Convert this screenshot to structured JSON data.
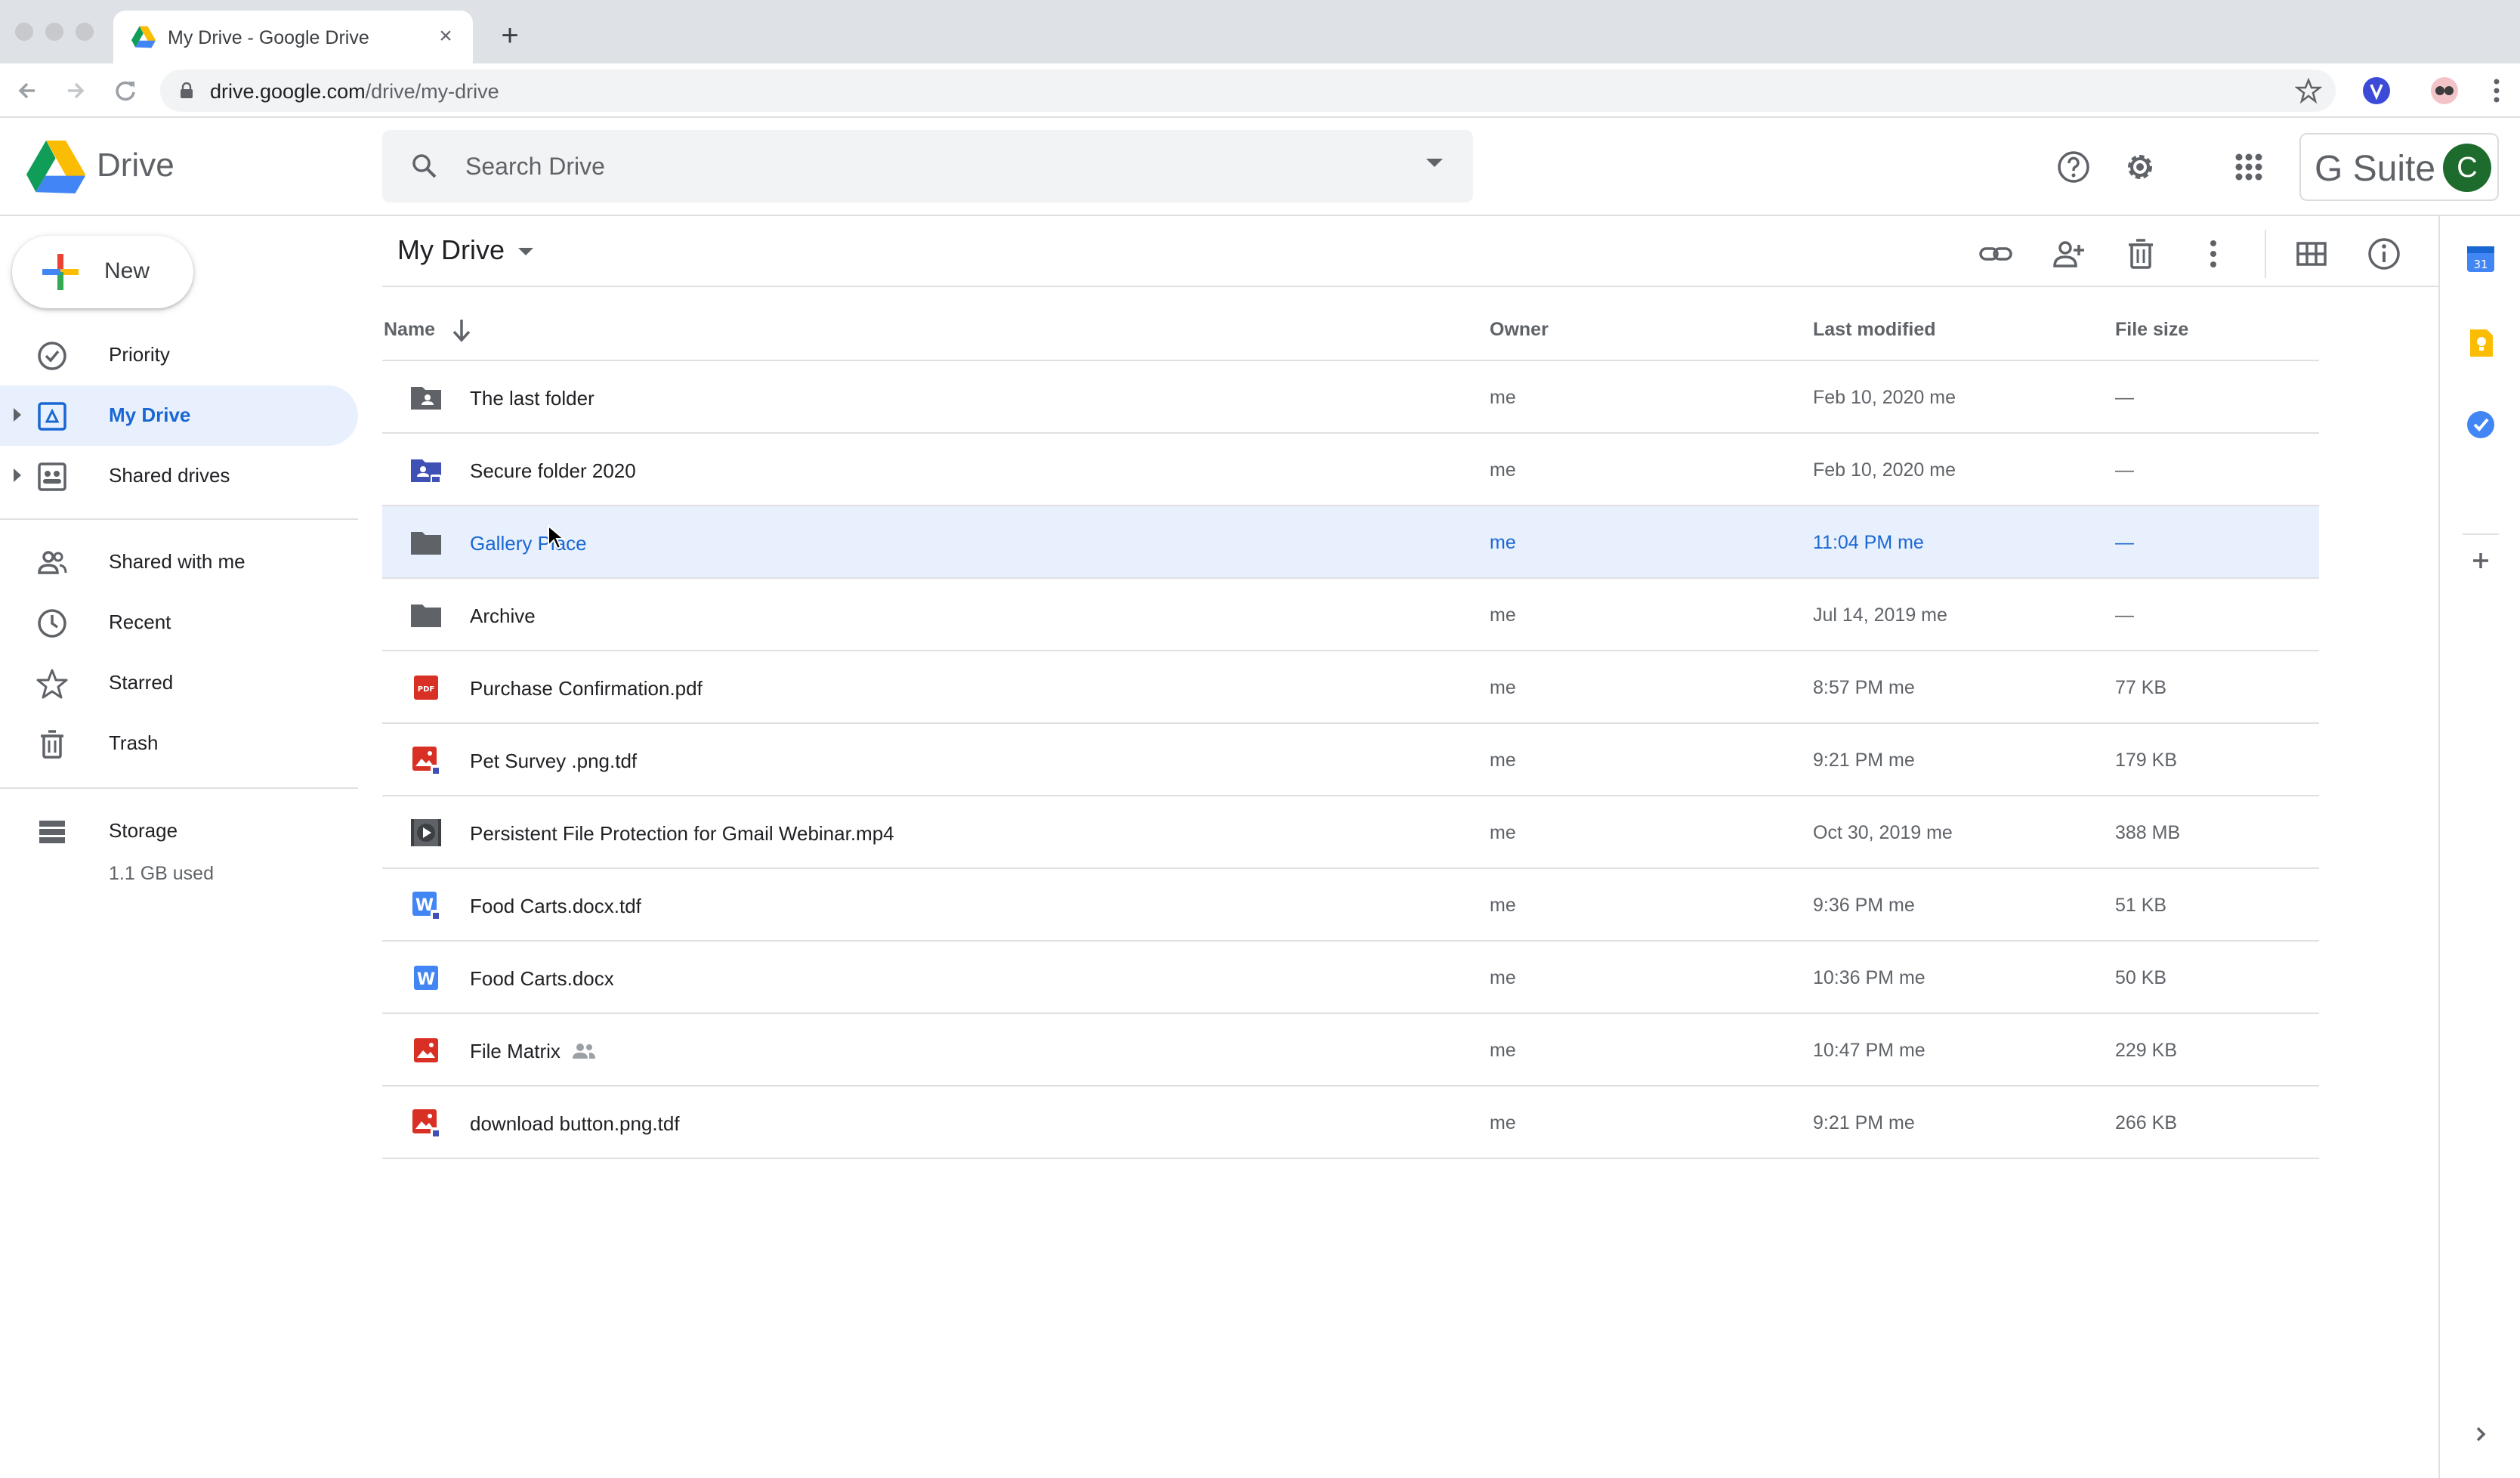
{
  "browser": {
    "tab_title": "My Drive - Google Drive",
    "url_host": "drive.google.com",
    "url_path": "/drive/my-drive"
  },
  "header": {
    "product": "Drive",
    "search_placeholder": "Search Drive",
    "gsuite_label": "G Suite",
    "avatar_letter": "C"
  },
  "sidebar": {
    "new_label": "New",
    "items": [
      {
        "label": "Priority",
        "icon": "priority-icon"
      },
      {
        "label": "My Drive",
        "icon": "my-drive-icon",
        "active": true
      },
      {
        "label": "Shared drives",
        "icon": "shared-drives-icon"
      },
      {
        "label": "Shared with me",
        "icon": "shared-with-me-icon"
      },
      {
        "label": "Recent",
        "icon": "clock-icon"
      },
      {
        "label": "Starred",
        "icon": "star-icon"
      },
      {
        "label": "Trash",
        "icon": "trash-icon"
      },
      {
        "label": "Storage",
        "icon": "storage-icon"
      }
    ],
    "storage_used": "1.1 GB used"
  },
  "main": {
    "breadcrumb": "My Drive",
    "columns": {
      "name": "Name",
      "owner": "Owner",
      "modified": "Last modified",
      "size": "File size"
    },
    "files": [
      {
        "name": "The last folder",
        "owner": "me",
        "modified": "Feb 10, 2020  me",
        "size": "—",
        "icon": "shared-folder-icon"
      },
      {
        "name": "Secure folder 2020",
        "owner": "me",
        "modified": "Feb 10, 2020  me",
        "size": "—",
        "icon": "secure-folder-icon"
      },
      {
        "name": "Gallery Place",
        "owner": "me",
        "modified": "11:04 PM  me",
        "size": "—",
        "icon": "folder-icon",
        "selected": true
      },
      {
        "name": "Archive",
        "owner": "me",
        "modified": "Jul 14, 2019  me",
        "size": "—",
        "icon": "folder-icon"
      },
      {
        "name": "Purchase Confirmation.pdf",
        "owner": "me",
        "modified": "8:57 PM  me",
        "size": "77 KB",
        "icon": "pdf-icon"
      },
      {
        "name": "Pet Survey .png.tdf",
        "owner": "me",
        "modified": "9:21 PM  me",
        "size": "179 KB",
        "icon": "secure-image-icon"
      },
      {
        "name": "Persistent File Protection for Gmail Webinar.mp4",
        "owner": "me",
        "modified": "Oct 30, 2019  me",
        "size": "388 MB",
        "icon": "video-icon"
      },
      {
        "name": "Food Carts.docx.tdf",
        "owner": "me",
        "modified": "9:36 PM  me",
        "size": "51 KB",
        "icon": "secure-word-icon"
      },
      {
        "name": "Food Carts.docx",
        "owner": "me",
        "modified": "10:36 PM  me",
        "size": "50 KB",
        "icon": "word-icon"
      },
      {
        "name": "File Matrix",
        "owner": "me",
        "modified": "10:47 PM  me",
        "size": "229 KB",
        "icon": "image-icon",
        "shared": true
      },
      {
        "name": "download button.png.tdf",
        "owner": "me",
        "modified": "9:21 PM  me",
        "size": "266 KB",
        "icon": "secure-image-icon"
      }
    ]
  },
  "side_panel": {
    "calendar_day": "31"
  },
  "colors": {
    "accent": "#1967d2",
    "selected_bg": "#e8f0fe",
    "pdf_red": "#d93025",
    "word_blue": "#4285f4",
    "avatar_green": "#1e6b2e"
  }
}
